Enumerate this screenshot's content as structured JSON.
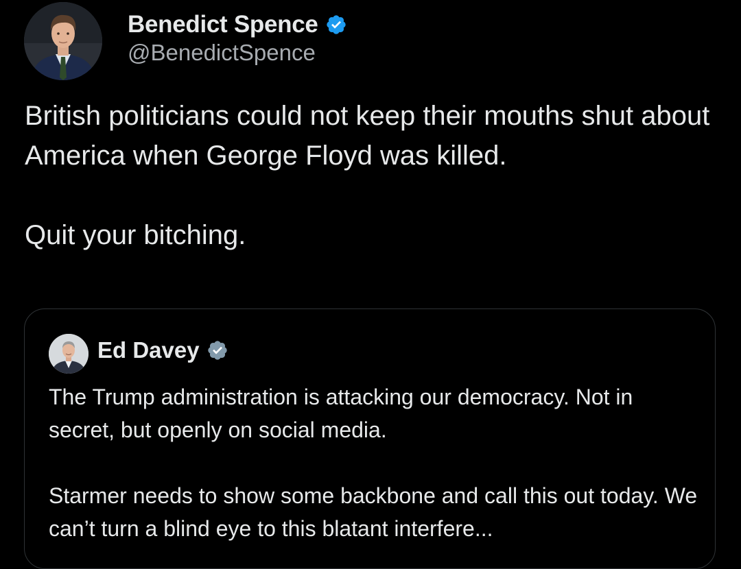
{
  "author": {
    "name": "Benedict Spence",
    "handle": "@BenedictSpence"
  },
  "tweet": {
    "paragraph_1": "British politicians could not keep their mouths shut about America when George Floyd was killed.",
    "paragraph_2": "Quit your bitching."
  },
  "quote": {
    "author_name": "Ed Davey",
    "paragraph_1": "The Trump administration is attacking our democracy. Not in secret, but openly on social media.",
    "paragraph_2": "Starmer needs to show some backbone and call this out today. We can’t turn a blind eye to this blatant interfere..."
  },
  "colors": {
    "background": "#000000",
    "text": "#e7e9ea",
    "handle": "#a8acb1",
    "verified_blue": "#1d9bf0",
    "verified_grey": "#829aab",
    "card_border": "#2f3336"
  },
  "icons": {
    "author_badge": "verified-blue-badge",
    "quote_badge": "verified-grey-badge"
  }
}
